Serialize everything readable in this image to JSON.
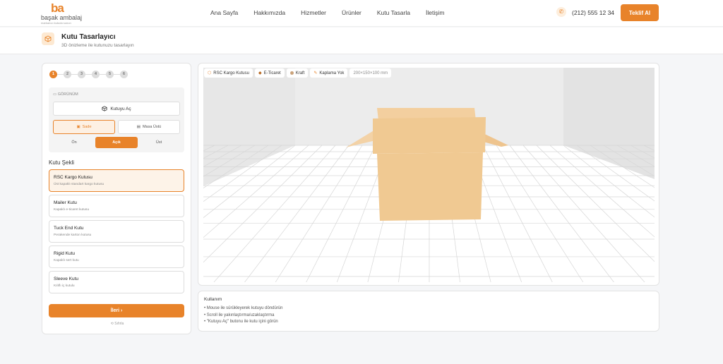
{
  "brand": {
    "mark": "ba",
    "name": "başak ambalaj",
    "tagline": "markanızı kutuda sunun"
  },
  "nav": [
    "Ana Sayfa",
    "Hakkımızda",
    "Hizmetler",
    "Ürünler",
    "Kutu Tasarla",
    "İletişim"
  ],
  "header": {
    "phone": "(212) 555 12 34",
    "cta": "Teklif Al"
  },
  "page": {
    "title": "Kutu Tasarlayıcı",
    "subtitle": "3D önizleme ile kutunuzu tasarlayın"
  },
  "steps": [
    "1",
    "2",
    "3",
    "4",
    "5",
    "6"
  ],
  "active_step": 1,
  "view": {
    "header": "GÖRÜNÜM",
    "open_box": "Kutuyu Aç",
    "modes": [
      "Sade",
      "Masa Üstü"
    ],
    "active_mode": "Sade",
    "cameras": [
      "Ön",
      "Açık",
      "Üst"
    ],
    "active_camera": "Açık"
  },
  "shape_section_title": "Kutu Şekli",
  "shapes": [
    {
      "name": "RSC Kargo Kutusu",
      "desc": "Üst kapaklı standart kargo kutusu",
      "active": true
    },
    {
      "name": "Mailer Kutu",
      "desc": "Kapaklı e-ticaret kutusu",
      "active": false
    },
    {
      "name": "Tuck End Kutu",
      "desc": "Perakende karton kutusu",
      "active": false
    },
    {
      "name": "Rigid Kutu",
      "desc": "Kapaklı sert kutu",
      "active": false
    },
    {
      "name": "Sleeve Kutu",
      "desc": "Kılıflı iç kutulu",
      "active": false
    }
  ],
  "next_label": "İleri ›",
  "reset_label": "Sıfırla",
  "chips": [
    {
      "label": "RSC Kargo Kutusu",
      "icon": "box-icon"
    },
    {
      "label": "E-Ticaret",
      "icon": "cube-icon"
    },
    {
      "label": "Kraft",
      "icon": "dot-icon"
    },
    {
      "label": "Kaplama Yok",
      "icon": "brush-icon"
    },
    {
      "label": "200×150×100 mm",
      "icon": ""
    }
  ],
  "colors": {
    "accent": "#e8832a",
    "box": "#f0c992",
    "box_side": "#e9bd83",
    "box_flap": "#f3d2a6"
  },
  "usage": {
    "title": "Kullanım",
    "items": [
      "• Mouse ile sürükleyerek kutuyu döndürün",
      "• Scroll ile yakınlaştırma/uzaklaştırma",
      "• \"Kutuyu Aç\" butonu ile kutu içini görün"
    ]
  }
}
